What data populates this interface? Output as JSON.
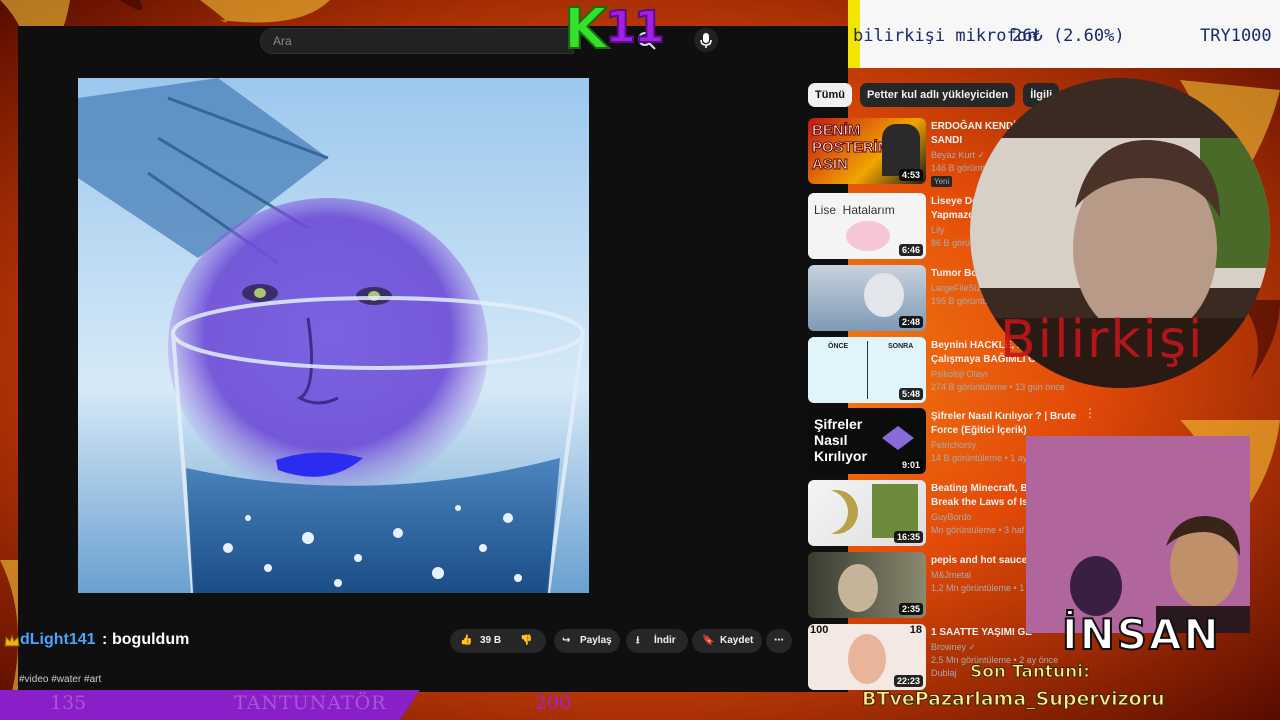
{
  "overlay": {
    "logo_k": "K",
    "logo_num": "11",
    "ticker": {
      "name": "bilirkişi mikrofon",
      "price": "26₺ (2.60%)",
      "symbol": "TRY1000"
    },
    "webcam_name": "Bilirkişi",
    "insan_label": "İNSAN",
    "son_tantuni": "Son Tantuni:",
    "last_donor": "BTvePazarlama_Supervizoru",
    "bottom_bar": {
      "left_count": "135",
      "title": "TANTUNATÖR",
      "right_count": "200"
    },
    "chat": {
      "user": "dLight141",
      "separator": ":",
      "message": "boguldum"
    }
  },
  "youtube": {
    "search_placeholder": "Ara",
    "chips": [
      "Tümü",
      "Petter kul adlı yükleyiciden",
      "İlgili"
    ],
    "actions": {
      "likes": "39 B",
      "share": "Paylaş",
      "download": "İndir",
      "save": "Kaydet"
    },
    "hashtags": "#video #water #art",
    "recommendations": [
      {
        "title": "ERDOĞAN KENDİ\nSANDI",
        "channel": "Beyaz Kurt",
        "verified": true,
        "meta": "146 B görüntü",
        "badge": "Yeni",
        "duration": "4:53",
        "thumb_text": "BENİM POSTERİM ASIN"
      },
      {
        "title": "Liseye Dö\nYapmazd",
        "channel": "Lily",
        "meta": "86 B görün",
        "duration": "6:46",
        "thumb_text": "Lise  Hatalarım"
      },
      {
        "title": "Tumor Boy",
        "channel": "LargeFileSize",
        "meta": "195 B görüntüle",
        "duration": "2:48"
      },
      {
        "title": "Beynini HACKLE, Ders\nÇalışmaya BAĞIMLI Ol",
        "channel": "Psikoloji Olayı",
        "meta": "274 B görüntüleme • 13 gün önce",
        "duration": "5:48",
        "thumb_text_a": "ÖNCE",
        "thumb_text_b": "SONRA"
      },
      {
        "title": "Şifreler Nasıl Kırılıyor ? | Brute\nForce (Eğitici İçerik)",
        "channel": "Petrichorsy",
        "meta": "14 B görüntüleme • 1 ay",
        "duration": "9:01",
        "thumb_text": "Şifreler Nasıl Kırılıyor"
      },
      {
        "title": "Beating Minecraft, Bu\nBreak the Laws of Isla",
        "channel": "GuyBordo",
        "meta": "Mn görüntüleme • 3 haf",
        "duration": "16:35"
      },
      {
        "title": "pepis and hot sauce",
        "channel": "M&Jmetal",
        "meta": "1,2 Mn görüntüleme • 1 a",
        "duration": "2:35"
      },
      {
        "title": "1 SAATTE YAŞIMI GE",
        "channel": "Browney",
        "verified": true,
        "meta": "2,5 Mn görüntüleme • 2 ay önce",
        "duration": "22:23",
        "thumb_text_a": "100",
        "thumb_text_b": "18",
        "extra": "Dublaj"
      }
    ]
  },
  "colors": {
    "accent": "#8a1ec9",
    "k_green": "#35e22a",
    "num_purple": "#a220e6",
    "ticker_text": "#1a2a6b",
    "name_red": "#c2151a"
  }
}
